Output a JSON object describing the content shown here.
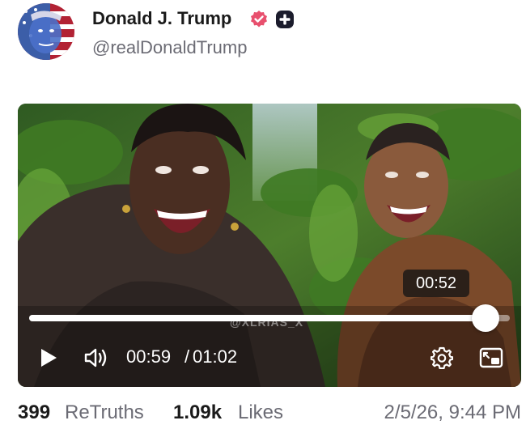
{
  "author": {
    "name": "Donald J. Trump",
    "handle": "@realDonaldTrump",
    "verified_icon": "verified-badge-icon",
    "plus_icon": "plus-badge-icon",
    "verified_color": "#e8506e"
  },
  "video": {
    "watermark": "@XLRIAS_X",
    "tooltip_time": "00:52",
    "current_time": "00:59",
    "separator": "/",
    "total_time": "01:02",
    "progress": 0.95,
    "icons": [
      "play-icon",
      "volume-icon",
      "settings-icon",
      "picture-in-picture-icon"
    ]
  },
  "stats": {
    "retruths_count": "399",
    "retruths_label": "ReTruths",
    "likes_count": "1.09k",
    "likes_label": "Likes",
    "timestamp": "2/5/26, 9:44 PM"
  }
}
